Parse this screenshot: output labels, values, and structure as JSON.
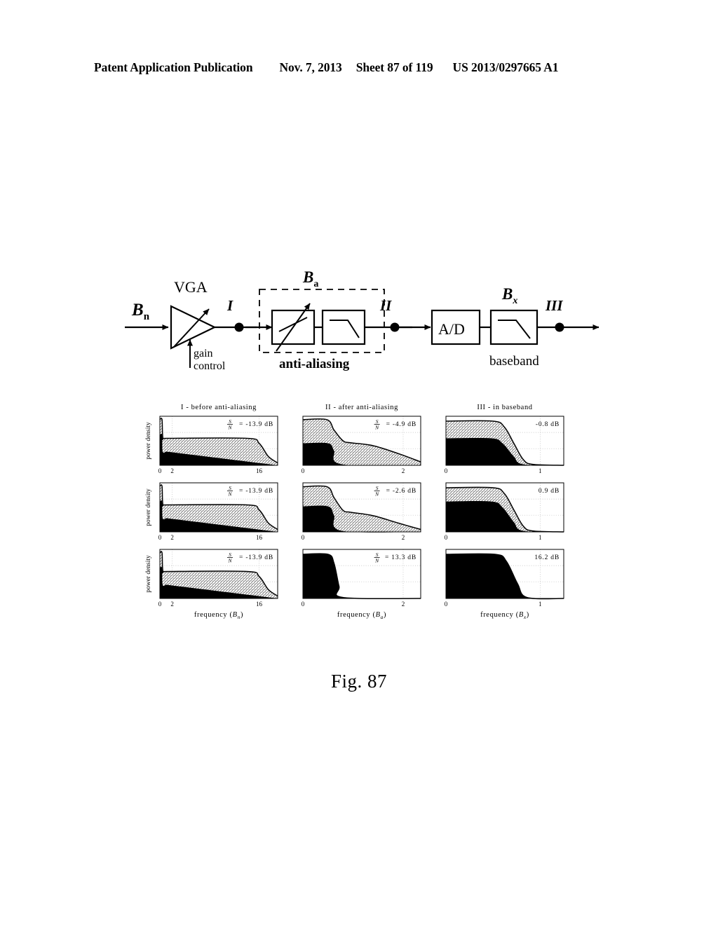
{
  "header": {
    "publication": "Patent Application Publication",
    "date": "Nov. 7, 2013",
    "sheet": "Sheet 87 of 119",
    "patent_number": "US 2013/0297665 A1"
  },
  "figure": {
    "caption": "Fig. 87"
  },
  "diagram": {
    "input_label": "B",
    "input_sub": "n",
    "vga_label": "VGA",
    "gain_control_line1": "gain",
    "gain_control_line2": "control",
    "node_I": "I",
    "node_II": "II",
    "node_III": "III",
    "ba_label": "B",
    "ba_sub": "a",
    "antialiasing_label": "anti-aliasing",
    "ad_label": "A/D",
    "bx_label": "B",
    "bx_sub": "x",
    "baseband_label": "baseband"
  },
  "plots": {
    "column_titles": [
      "I - before anti-aliasing",
      "II - after anti-aliasing",
      "III - in baseband"
    ],
    "y_axis_label": "power density",
    "x_axis_labels": [
      {
        "text": "frequency (",
        "sub_base": "B",
        "sub": "n",
        "close": ")"
      },
      {
        "text": "frequency (",
        "sub_base": "B",
        "sub": "a",
        "close": ")"
      },
      {
        "text": "frequency (",
        "sub_base": "B",
        "sub": "x",
        "close": ")"
      }
    ],
    "snr_prefix_num": "S",
    "snr_prefix_den": "N",
    "snr_equals": "="
  },
  "chart_data": {
    "type": "area",
    "title": "Fig. 87 - power density spectra at three signal-chain nodes for three gain settings",
    "ylabel": "power density",
    "grid": true,
    "legend": "none",
    "panels": [
      {
        "row": 1,
        "col": 1,
        "column_title": "I - before anti-aliasing",
        "xlabel": "frequency (B_n)",
        "xticks": [
          0,
          2,
          16
        ],
        "xlim": [
          0,
          19
        ],
        "ylim": [
          0,
          1
        ],
        "snr_label": "S/N = -13.9 dB",
        "snr_value": -13.9,
        "snr_units": "dB",
        "signal_black": {
          "description": "narrow signal spike near 0",
          "x": [
            0,
            0.35,
            0.45,
            1.0
          ],
          "y": [
            0.62,
            0.62,
            0.28,
            0.28
          ]
        },
        "noise_total": {
          "description": "total = signal + noise envelope, flat then rolls off after 14",
          "x": [
            0,
            0.35,
            0.5,
            1.2,
            14,
            16,
            17.5,
            19
          ],
          "y": [
            0.93,
            0.93,
            0.55,
            0.55,
            0.55,
            0.45,
            0.18,
            0.05
          ]
        }
      },
      {
        "row": 1,
        "col": 2,
        "column_title": "II - after anti-aliasing",
        "xlabel": "frequency (B_a)",
        "xticks": [
          0,
          2
        ],
        "xlim": [
          0,
          2.35
        ],
        "ylim": [
          0,
          1
        ],
        "snr_label": "S/N = -4.9 dB",
        "snr_value": -4.9,
        "snr_units": "dB",
        "signal_black": {
          "description": "black band from 0 to ~0.6 then drops",
          "x": [
            0,
            0.5,
            0.62,
            0.78,
            2.35
          ],
          "y": [
            0.45,
            0.45,
            0.3,
            0.02,
            0.0
          ]
        },
        "noise_total": {
          "description": "flat top to 0.5, steep drop, shallow shelf, tail",
          "x": [
            0,
            0.48,
            0.62,
            0.8,
            0.95,
            1.4,
            1.9,
            2.35
          ],
          "y": [
            0.93,
            0.93,
            0.72,
            0.5,
            0.46,
            0.4,
            0.24,
            0.07
          ]
        }
      },
      {
        "row": 1,
        "col": 3,
        "column_title": "III - in baseband",
        "xlabel": "frequency (B_x)",
        "xticks": [
          0,
          1
        ],
        "xlim": [
          0,
          1.25
        ],
        "ylim": [
          0,
          1
        ],
        "snr_label": "-0.8 dB",
        "snr_value": -0.8,
        "snr_units": "dB",
        "signal_black": {
          "description": "black band to ~0.5 then sigmoid drop",
          "x": [
            0,
            0.48,
            0.6,
            0.72,
            0.82,
            1.25
          ],
          "y": [
            0.55,
            0.55,
            0.45,
            0.18,
            0.02,
            0.0
          ]
        },
        "noise_total": {
          "description": "flat top then sigmoid drop to zero",
          "x": [
            0,
            0.5,
            0.62,
            0.72,
            0.82,
            0.92,
            1.25
          ],
          "y": [
            0.9,
            0.9,
            0.78,
            0.45,
            0.12,
            0.02,
            0.0
          ]
        }
      },
      {
        "row": 2,
        "col": 1,
        "column_title": "I - before anti-aliasing",
        "xlabel": "frequency (B_n)",
        "xticks": [
          0,
          2,
          16
        ],
        "xlim": [
          0,
          19
        ],
        "ylim": [
          0,
          1
        ],
        "snr_label": "S/N = -13.9 dB",
        "snr_value": -13.9,
        "snr_units": "dB",
        "signal_black": {
          "description": "narrow signal spike near 0",
          "x": [
            0,
            0.35,
            0.45,
            1.0
          ],
          "y": [
            0.62,
            0.62,
            0.28,
            0.28
          ]
        },
        "noise_total": {
          "description": "same as row 1 col 1",
          "x": [
            0,
            0.35,
            0.5,
            1.2,
            14,
            16,
            17.5,
            19
          ],
          "y": [
            0.93,
            0.93,
            0.55,
            0.55,
            0.55,
            0.45,
            0.18,
            0.05
          ]
        }
      },
      {
        "row": 2,
        "col": 2,
        "column_title": "II - after anti-aliasing",
        "xlabel": "frequency (B_a)",
        "xticks": [
          0,
          2
        ],
        "xlim": [
          0,
          2.35
        ],
        "ylim": [
          0,
          1
        ],
        "snr_label": "S/N = -2.6 dB",
        "snr_value": -2.6,
        "snr_units": "dB",
        "signal_black": {
          "description": "taller black band to ~0.6 then drops",
          "x": [
            0,
            0.5,
            0.62,
            0.78,
            2.35
          ],
          "y": [
            0.52,
            0.52,
            0.34,
            0.02,
            0.0
          ]
        },
        "noise_total": {
          "description": "flat top, steep drop, shelf, tail",
          "x": [
            0,
            0.48,
            0.62,
            0.8,
            0.95,
            1.4,
            1.9,
            2.35
          ],
          "y": [
            0.92,
            0.92,
            0.7,
            0.44,
            0.4,
            0.33,
            0.18,
            0.05
          ]
        }
      },
      {
        "row": 2,
        "col": 3,
        "column_title": "III - in baseband",
        "xlabel": "frequency (B_x)",
        "xticks": [
          0,
          1
        ],
        "xlim": [
          0,
          1.25
        ],
        "ylim": [
          0,
          1
        ],
        "snr_label": "0.9 dB",
        "snr_value": 0.9,
        "snr_units": "dB",
        "signal_black": {
          "description": "taller black band to ~0.5 then sigmoid drop",
          "x": [
            0,
            0.48,
            0.6,
            0.72,
            0.82,
            1.25
          ],
          "y": [
            0.62,
            0.62,
            0.5,
            0.2,
            0.02,
            0.0
          ]
        },
        "noise_total": {
          "description": "flat top then sigmoid drop to zero",
          "x": [
            0,
            0.5,
            0.62,
            0.72,
            0.82,
            0.92,
            1.25
          ],
          "y": [
            0.9,
            0.9,
            0.78,
            0.45,
            0.12,
            0.02,
            0.0
          ]
        }
      },
      {
        "row": 3,
        "col": 1,
        "column_title": "I - before anti-aliasing",
        "xlabel": "frequency (B_n)",
        "xticks": [
          0,
          2,
          16
        ],
        "xlim": [
          0,
          19
        ],
        "ylim": [
          0,
          1
        ],
        "snr_label": "S/N = -13.9 dB",
        "snr_value": -13.9,
        "snr_units": "dB",
        "signal_black": {
          "description": "narrow signal spike near 0",
          "x": [
            0,
            0.35,
            0.45,
            1.0
          ],
          "y": [
            0.62,
            0.62,
            0.28,
            0.28
          ]
        },
        "noise_total": {
          "description": "same as rows above",
          "x": [
            0,
            0.35,
            0.5,
            1.2,
            14,
            16,
            17.5,
            19
          ],
          "y": [
            0.93,
            0.93,
            0.55,
            0.55,
            0.55,
            0.45,
            0.18,
            0.05
          ]
        }
      },
      {
        "row": 3,
        "col": 2,
        "column_title": "II - after anti-aliasing",
        "xlabel": "frequency (B_a)",
        "xticks": [
          0,
          2
        ],
        "xlim": [
          0,
          2.35
        ],
        "ylim": [
          0,
          1
        ],
        "snr_label": "S/N = 13.3 dB",
        "snr_value": 13.3,
        "snr_units": "dB",
        "signal_black": {
          "description": "fully saturated black block to ~0.6 then sharp drop",
          "x": [
            0,
            0.5,
            0.62,
            0.72,
            0.8,
            2.35
          ],
          "y": [
            0.9,
            0.9,
            0.72,
            0.25,
            0.02,
            0.0
          ]
        },
        "noise_total": {
          "description": "noise coincides with signal (signal dominant)",
          "x": [
            0,
            0.5,
            0.62,
            0.72,
            0.8,
            2.35
          ],
          "y": [
            0.9,
            0.9,
            0.72,
            0.25,
            0.02,
            0.0
          ]
        }
      },
      {
        "row": 3,
        "col": 3,
        "column_title": "III - in baseband",
        "xlabel": "frequency (B_x)",
        "xticks": [
          0,
          1
        ],
        "xlim": [
          0,
          1.25
        ],
        "ylim": [
          0,
          1
        ],
        "snr_label": "16.2 dB",
        "snr_value": 16.2,
        "snr_units": "dB",
        "signal_black": {
          "description": "fully saturated black block to ~0.55 then sigmoid drop",
          "x": [
            0,
            0.52,
            0.64,
            0.76,
            0.86,
            1.25
          ],
          "y": [
            0.9,
            0.9,
            0.76,
            0.3,
            0.02,
            0.0
          ]
        },
        "noise_total": {
          "description": "noise coincides with signal (signal dominant)",
          "x": [
            0,
            0.52,
            0.64,
            0.76,
            0.86,
            1.25
          ],
          "y": [
            0.9,
            0.9,
            0.76,
            0.3,
            0.02,
            0.0
          ]
        }
      }
    ]
  }
}
